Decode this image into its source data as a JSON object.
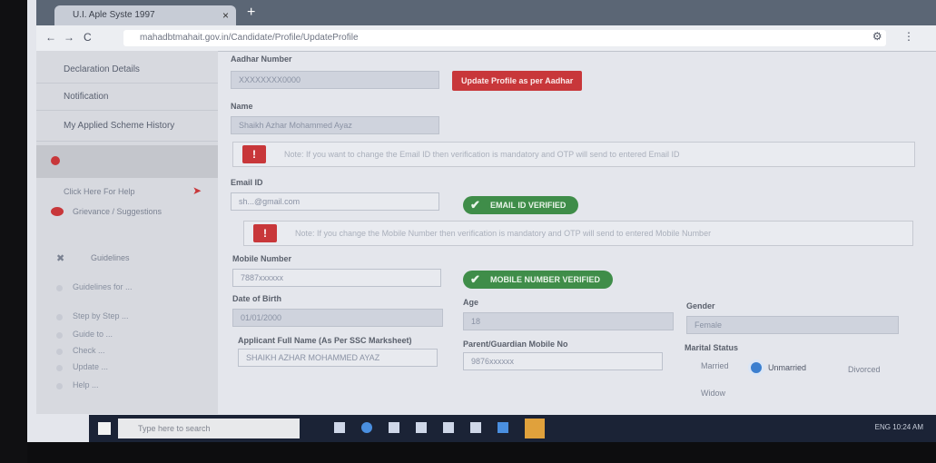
{
  "browser": {
    "tab_title": "U.I. Aple Syste 1997",
    "tab_close": "×",
    "new_tab": "+",
    "url": "mahadbtmahait.gov.in/Candidate/Profile/UpdateProfile",
    "nav": {
      "back": "←",
      "forward": "→",
      "reload": "C"
    },
    "menu": "⚙ ⋮"
  },
  "sidebar": {
    "items": [
      {
        "label": "Declaration Details"
      },
      {
        "label": "Notification"
      },
      {
        "label": "My Applied Scheme History"
      }
    ],
    "help_label": "Click Here For Help",
    "grievance_label": "Grievance / Suggestions",
    "guidelines_label": "Guidelines",
    "sub_items": [
      "Guidelines for ...",
      "Step by Step ...",
      "Guide to ...",
      "Check ...",
      "Update ...",
      "Help ..."
    ]
  },
  "form": {
    "aadhaar_label": "Aadhar Number",
    "aadhaar_value": "XXXXXXXX0000",
    "update_button": "Update Profile as per Aadhar",
    "name_label": "Name",
    "name_value": "Shaikh Azhar Mohammed Ayaz",
    "email_notice": "Note: If you want to change the Email ID then verification is mandatory and OTP will send to entered Email ID",
    "email_label": "Email ID",
    "email_value": "sh...@gmail.com",
    "email_verified": "EMAIL ID VERIFIED",
    "mobile_notice": "Note: If you change the Mobile Number then verification is mandatory and OTP will send to entered Mobile Number",
    "mobile_label": "Mobile Number",
    "mobile_value": "7887xxxxxx",
    "mobile_verified": "MOBILE NUMBER VERIFIED",
    "dob_label": "Date of Birth",
    "dob_value": "01/01/2000",
    "age_label": "Age",
    "age_value": "18",
    "gender_label": "Gender",
    "gender_value": "Female",
    "fullname_ssc_label": "Applicant Full Name (As Per SSC Marksheet)",
    "fullname_ssc_value": "SHAIKH AZHAR MOHAMMED AYAZ",
    "parent_mobile_label": "Parent/Guardian Mobile No",
    "parent_mobile_value": "9876xxxxxx",
    "marital_label": "Marital Status",
    "marital_options": [
      "Married",
      "Unmarried",
      "Divorced",
      "Widow"
    ]
  },
  "taskbar": {
    "search_placeholder": "Type here to search",
    "tray_text": "ENG 10:24 AM"
  },
  "colors": {
    "red": "#c8373a",
    "green": "#3f8d49",
    "blue": "#3c7fcf"
  }
}
